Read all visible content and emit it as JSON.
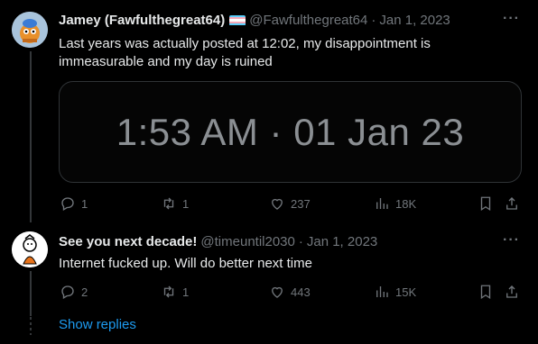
{
  "tweet1": {
    "name": "Jamey (Fawfulthegreat64)",
    "handle": "@Fawfulthegreat64",
    "separator": "·",
    "date": "Jan 1, 2023",
    "more": "···",
    "text": "Last years was actually posted at 12:02, my disappointment is immeasurable and my day is ruined",
    "media_text": "1:53 AM · 01 Jan 23",
    "replies": "1",
    "retweets": "1",
    "likes": "237",
    "views": "18K"
  },
  "tweet2": {
    "name": "See you next decade!",
    "handle": "@timeuntil2030",
    "separator": "·",
    "date": "Jan 1, 2023",
    "more": "···",
    "text": "Internet fucked up. Will do better next time",
    "replies": "2",
    "retweets": "1",
    "likes": "443",
    "views": "15K"
  },
  "show_replies": "Show replies",
  "colors": {
    "background": "#000000",
    "text": "#e7e9ea",
    "muted": "#71767b",
    "link": "#1d9bf0",
    "border": "#2f3336"
  }
}
